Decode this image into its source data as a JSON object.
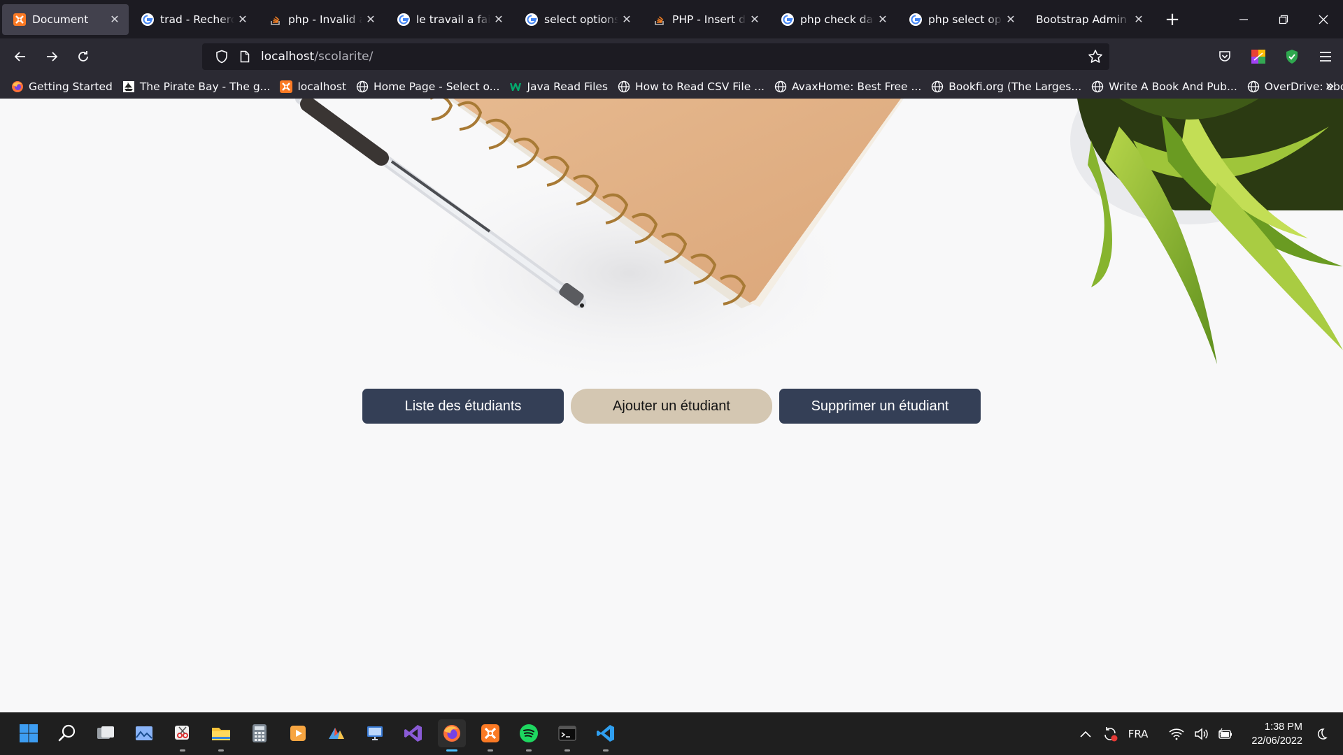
{
  "browser": {
    "tabs": [
      {
        "title": "Document",
        "icon": "xampp-icon",
        "active": true
      },
      {
        "title": "trad - Recherche Google",
        "icon": "google-icon",
        "active": false
      },
      {
        "title": "php - Invalid argument",
        "icon": "stackoverflow-icon",
        "active": false
      },
      {
        "title": "le travail a faire - Recherche",
        "icon": "google-icon",
        "active": false
      },
      {
        "title": "select options html",
        "icon": "google-icon",
        "active": false
      },
      {
        "title": "PHP - Insert date",
        "icon": "stackoverflow-icon",
        "active": false
      },
      {
        "title": "php check date google",
        "icon": "google-icon",
        "active": false
      },
      {
        "title": "php select option",
        "icon": "google-icon",
        "active": false
      },
      {
        "title": "Bootstrap Admin Theme",
        "icon": "none",
        "active": false
      }
    ],
    "new_tab_label": "+",
    "url": {
      "host": "localhost",
      "path": "/scolarite/"
    },
    "bookmarks": [
      {
        "label": "Getting Started",
        "icon": "firefox-icon"
      },
      {
        "label": "The Pirate Bay - The g...",
        "icon": "pirate-ship-icon"
      },
      {
        "label": "localhost",
        "icon": "xampp-icon"
      },
      {
        "label": "Home Page - Select o...",
        "icon": "globe-icon"
      },
      {
        "label": "Java Read Files",
        "icon": "w3schools-icon"
      },
      {
        "label": "How to Read CSV File ...",
        "icon": "globe-icon"
      },
      {
        "label": "AvaxHome: Best Free ...",
        "icon": "globe-icon"
      },
      {
        "label": "Bookfi.org (The Larges...",
        "icon": "globe-icon"
      },
      {
        "label": "Write A Book And Pub...",
        "icon": "globe-icon"
      },
      {
        "label": "OverDrive: ebooks, au...",
        "icon": "globe-icon"
      }
    ]
  },
  "page": {
    "buttons": {
      "list": "Liste des étudiants",
      "add": "Ajouter un étudiant",
      "delete": "Supprimer un étudiant"
    },
    "colors": {
      "primary": "#343f56",
      "secondary": "#d4c7b2"
    }
  },
  "taskbar": {
    "apps": [
      "start-icon",
      "search-icon",
      "task-view-icon",
      "photos-icon",
      "snipping-tool-icon",
      "file-explorer-icon",
      "calculator-icon",
      "media-player-icon",
      "paint-icon",
      "remote-desktop-icon",
      "visual-studio-icon",
      "firefox-icon",
      "xampp-icon",
      "spotify-icon",
      "terminal-icon",
      "vscode-icon"
    ],
    "language": "FRA",
    "time": "1:38 PM",
    "date": "22/06/2022"
  }
}
